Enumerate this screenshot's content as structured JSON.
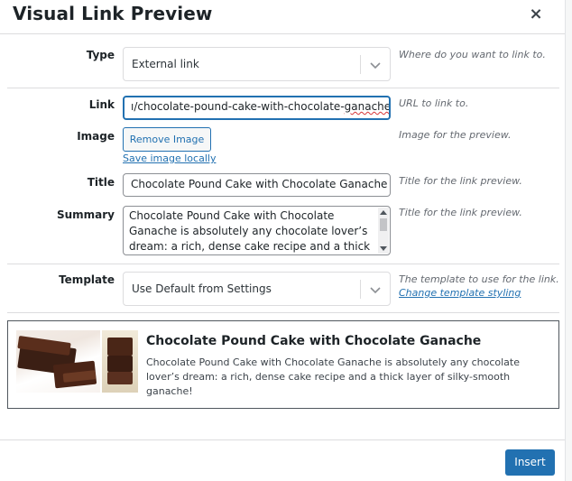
{
  "dialog": {
    "title": "Visual Link Preview",
    "close_label": "×"
  },
  "type": {
    "label": "Type",
    "value": "External link",
    "description": "Where do you want to link to."
  },
  "link": {
    "label": "Link",
    "value": "\u0002/chocolate-pound-cake-with-chocolate-ganache/",
    "value_visible_prefix": "\u0002/chocolate-pound-cake-with-chocolate-",
    "value_visible_misspelled": "ganache",
    "value_visible_suffix": "/",
    "description": "URL to link to."
  },
  "image": {
    "label": "Image",
    "remove_label": "Remove Image",
    "save_locally_label": "Save image locally",
    "description": "Image for the preview."
  },
  "title_field": {
    "label": "Title",
    "value": "Chocolate Pound Cake with Chocolate Ganache",
    "description": "Title for the link preview."
  },
  "summary": {
    "label": "Summary",
    "value": "Chocolate Pound Cake with Chocolate Ganache is absolutely any chocolate lover’s dream: a rich, dense cake recipe and a thick layer of",
    "description": "Title for the link preview."
  },
  "template": {
    "label": "Template",
    "value": "Use Default from Settings",
    "description": "The template to use for the link.",
    "link_label": "Change template styling"
  },
  "preview": {
    "title": "Chocolate Pound Cake with Chocolate Ganache",
    "text": "Chocolate Pound Cake with Chocolate Ganache is absolutely any chocolate lover’s dream: a rich, dense cake recipe and a thick layer of silky-smooth ganache!"
  },
  "footer": {
    "insert_label": "Insert"
  },
  "colors": {
    "accent": "#2271b1",
    "text": "#1d2327",
    "muted": "#646970",
    "border": "#dcdcde",
    "error_underline": "#d63638"
  },
  "icons": {
    "close": "close-icon",
    "chevron": "chevron-down-icon"
  }
}
